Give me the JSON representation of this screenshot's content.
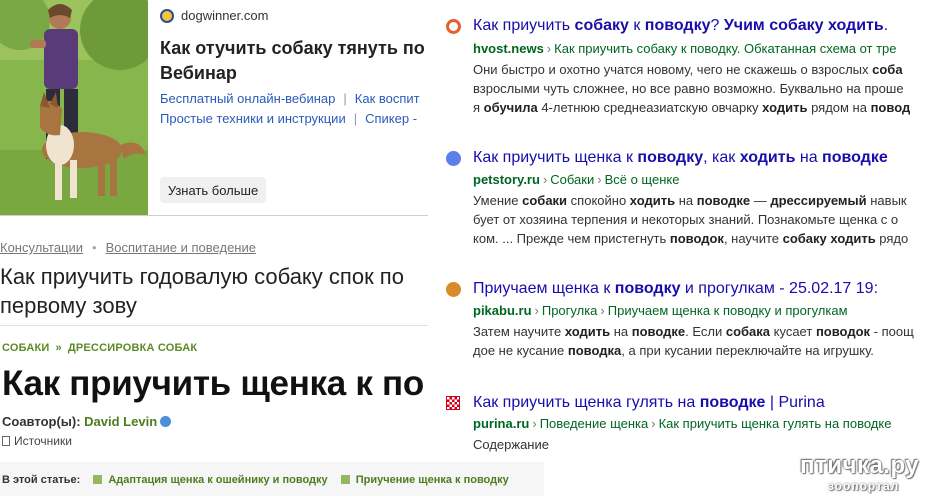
{
  "ad": {
    "domain": "dogwinner.com",
    "title": "Как отучить собаку тянуть по Вебинар",
    "links_row1": [
      "Бесплатный онлайн-вебинар",
      "Как воспит"
    ],
    "links_row2": [
      "Простые техники и инструкции",
      "Спикер -"
    ],
    "button": "Узнать больше"
  },
  "article": {
    "breadcrumb": [
      "Консультации",
      "Воспитание и поведение"
    ],
    "title": "Как приучить годовалую собаку спок по первому зову"
  },
  "wikihow": {
    "crumbs": [
      "СОБАКИ",
      "ДРЕССИРОВКА СОБАК"
    ],
    "crumb_arrow": "»",
    "title": "Как приучить щенка к по",
    "coauthor_label": "Соавтор(ы):",
    "coauthor_name": "David Levin",
    "sources": "Источники",
    "toc_label": "В этой статье:",
    "toc_items": [
      "Адаптация щенка к ошейнику и поводку",
      "Приучение щенка к поводку"
    ]
  },
  "results": [
    {
      "favicon_color": "#e8602c",
      "title_parts": [
        [
          "Как приучить ",
          false
        ],
        [
          "собаку",
          true
        ],
        [
          " к ",
          false
        ],
        [
          "поводку",
          true
        ],
        [
          "? ",
          false
        ],
        [
          "Учим собаку ходить",
          true
        ],
        [
          ".",
          false
        ]
      ],
      "url_domain": "hvost.news",
      "url_path": "Как приучить собаку к поводку. Обкатанная схема от тре",
      "snippet_lines": [
        [
          [
            "Они быстро и охотно учатся новому, чего не скажешь о взрослых ",
            false
          ],
          [
            "соба",
            true
          ]
        ],
        [
          [
            "взрослыми чуть сложнее, но все равно возможно. Буквально на проше",
            false
          ]
        ],
        [
          [
            "я ",
            false
          ],
          [
            "обучила",
            true
          ],
          [
            " 4-летнюю среднеазиатскую овчарку ",
            false
          ],
          [
            "ходить",
            true
          ],
          [
            " рядом на ",
            false
          ],
          [
            "повод",
            true
          ]
        ]
      ]
    },
    {
      "favicon_color": "#5b7ee8",
      "title_parts": [
        [
          "Как приучить щенка к ",
          false
        ],
        [
          "поводку",
          true
        ],
        [
          ", как ",
          false
        ],
        [
          "ходить",
          true
        ],
        [
          " на ",
          false
        ],
        [
          "поводке",
          true
        ]
      ],
      "url_domain": "petstory.ru",
      "url_path": "Собаки",
      "url_path2": "Всё о щенке",
      "snippet_lines": [
        [
          [
            "Умение ",
            false
          ],
          [
            "собаки",
            true
          ],
          [
            " спокойно ",
            false
          ],
          [
            "ходить",
            true
          ],
          [
            " на ",
            false
          ],
          [
            "поводке",
            true
          ],
          [
            " — ",
            false
          ],
          [
            "дрессируемый",
            true
          ],
          [
            " навык",
            false
          ]
        ],
        [
          [
            "бует от хозяина терпения и некоторых знаний. Познакомьте щенка с о",
            false
          ]
        ],
        [
          [
            "ком. ... Прежде чем пристегнуть ",
            false
          ],
          [
            "поводок",
            true
          ],
          [
            ", научите ",
            false
          ],
          [
            "собаку",
            true
          ],
          [
            " ",
            false
          ],
          [
            "ходить",
            true
          ],
          [
            " рядо",
            false
          ]
        ]
      ]
    },
    {
      "favicon_color": "#d98a2b",
      "title_parts": [
        [
          "Приучаем щенка к ",
          false
        ],
        [
          "поводку",
          true
        ],
        [
          " и прогулкам - 25.02.17 19:",
          false
        ]
      ],
      "url_domain": "pikabu.ru",
      "url_path": "Прогулка",
      "url_path2": "Приучаем щенка к поводку и прогулкам",
      "snippet_lines": [
        [
          [
            "Затем научите ",
            false
          ],
          [
            "ходить",
            true
          ],
          [
            " на ",
            false
          ],
          [
            "поводке",
            true
          ],
          [
            ". Если ",
            false
          ],
          [
            "собака",
            true
          ],
          [
            " кусает ",
            false
          ],
          [
            "поводок",
            true
          ],
          [
            " - поощ",
            false
          ]
        ],
        [
          [
            "дое не кусание ",
            false
          ],
          [
            "поводка",
            true
          ],
          [
            ", а при кусании переключайте на игрушку.",
            false
          ]
        ]
      ]
    },
    {
      "favicon_color": "#d0021b",
      "title_parts": [
        [
          "Как приучить щенка гулять на ",
          false
        ],
        [
          "поводке",
          true
        ],
        [
          " | Purina",
          false
        ]
      ],
      "url_domain": "purina.ru",
      "url_path": "Поведение щенка",
      "url_path2": "Как приучить щенка гулять на поводке",
      "snippet_lines": [
        [
          [
            "Содержание",
            false
          ]
        ]
      ]
    }
  ],
  "watermark": {
    "main": "птичка.ру",
    "sub": "зоопортал"
  }
}
